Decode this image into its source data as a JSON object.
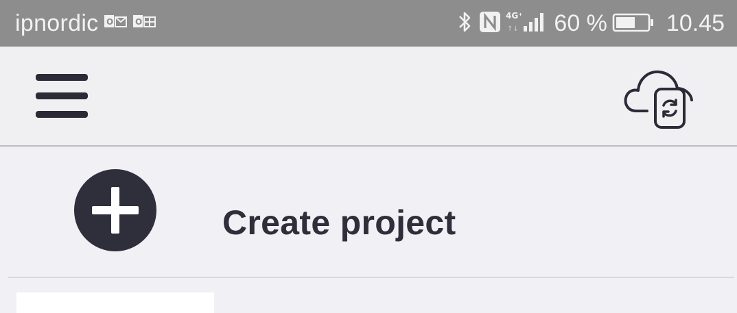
{
  "status_bar": {
    "carrier": "ipnordic",
    "battery_percent": "60 %",
    "time": "10.45",
    "network_type": "4G⁺",
    "icons": [
      "outlook-notification-icon",
      "office-notification-icon",
      "bluetooth-icon",
      "nfc-icon",
      "signal-icon",
      "battery-icon"
    ]
  },
  "app_bar": {
    "icons": [
      "menu-icon",
      "cloud-sync-icon"
    ]
  },
  "create_project": {
    "label": "Create project",
    "icon": "plus-circle-icon"
  },
  "colors": {
    "status_bar_bg": "#8d8d8d",
    "app_bar_bg": "#f0eff2",
    "content_bg": "#f1f0f5",
    "primary_dark": "#2f2e3b"
  }
}
